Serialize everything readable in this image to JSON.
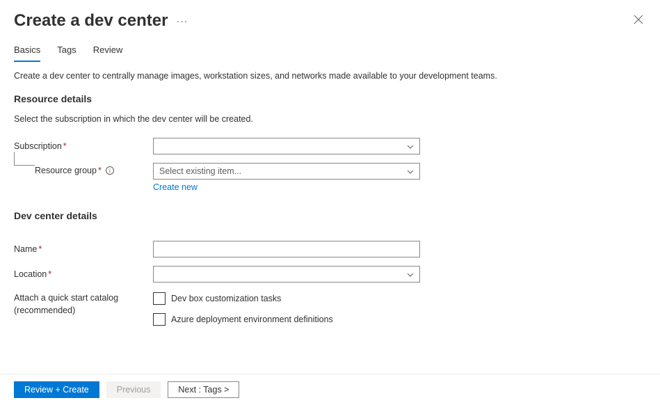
{
  "header": {
    "title": "Create a dev center"
  },
  "tabs": {
    "basics": "Basics",
    "tags": "Tags",
    "review": "Review"
  },
  "intro": "Create a dev center to centrally manage images, workstation sizes, and networks made available to your development teams.",
  "sections": {
    "resource_details": {
      "heading": "Resource details",
      "hint": "Select the subscription in which the dev center will be created.",
      "subscription_label": "Subscription",
      "resource_group_label": "Resource group",
      "resource_group_placeholder": "Select existing item...",
      "create_new_link": "Create new"
    },
    "devcenter_details": {
      "heading": "Dev center details",
      "name_label": "Name",
      "location_label": "Location",
      "catalog_label": "Attach a quick start catalog (recommended)",
      "checkbox1": "Dev box customization tasks",
      "checkbox2": "Azure deployment environment definitions"
    }
  },
  "footer": {
    "review_create": "Review + Create",
    "previous": "Previous",
    "next": "Next : Tags >"
  }
}
